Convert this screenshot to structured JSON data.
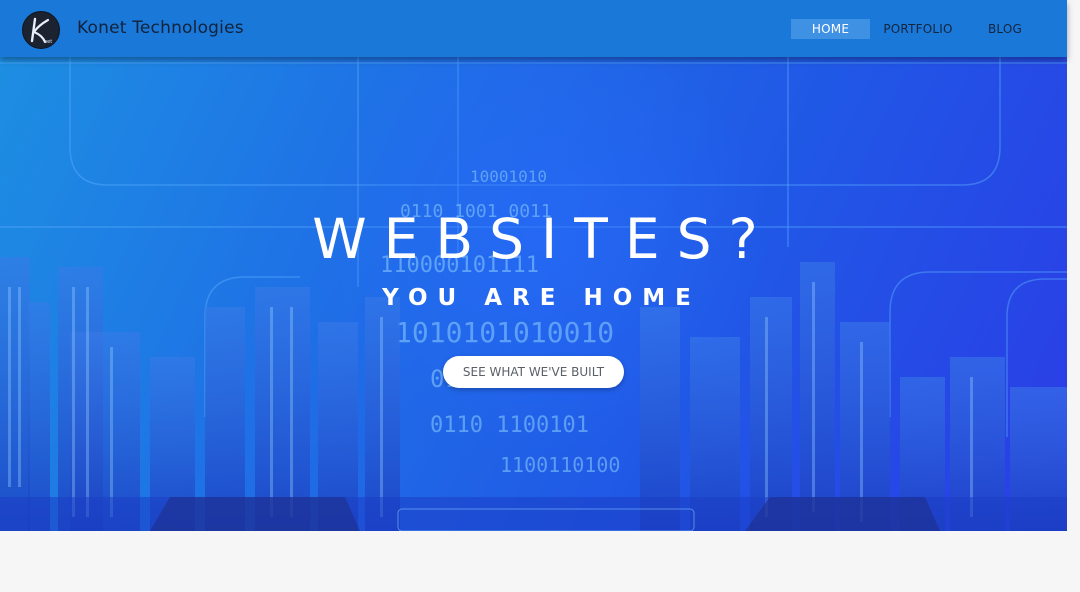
{
  "header": {
    "logo_icon": "konet-logo-icon",
    "brand": "Konet Technologies",
    "nav": [
      {
        "label": "HOME",
        "active": true
      },
      {
        "label": "PORTFOLIO",
        "active": false
      },
      {
        "label": "BLOG",
        "active": false
      }
    ]
  },
  "hero": {
    "title": "WEBSITES?",
    "subtitle": "YOU ARE HOME",
    "cta_label": "SEE WHAT WE'VE BUILT",
    "background": "city-skyline-binary-code-image"
  },
  "colors": {
    "header_bg": "#1a78d8",
    "nav_active_bg": "#3f91e4",
    "hero_gradient": [
      "#1d8ee2",
      "#2058e6",
      "#2b3ce6"
    ],
    "page_bg": "#f6f6f7"
  }
}
